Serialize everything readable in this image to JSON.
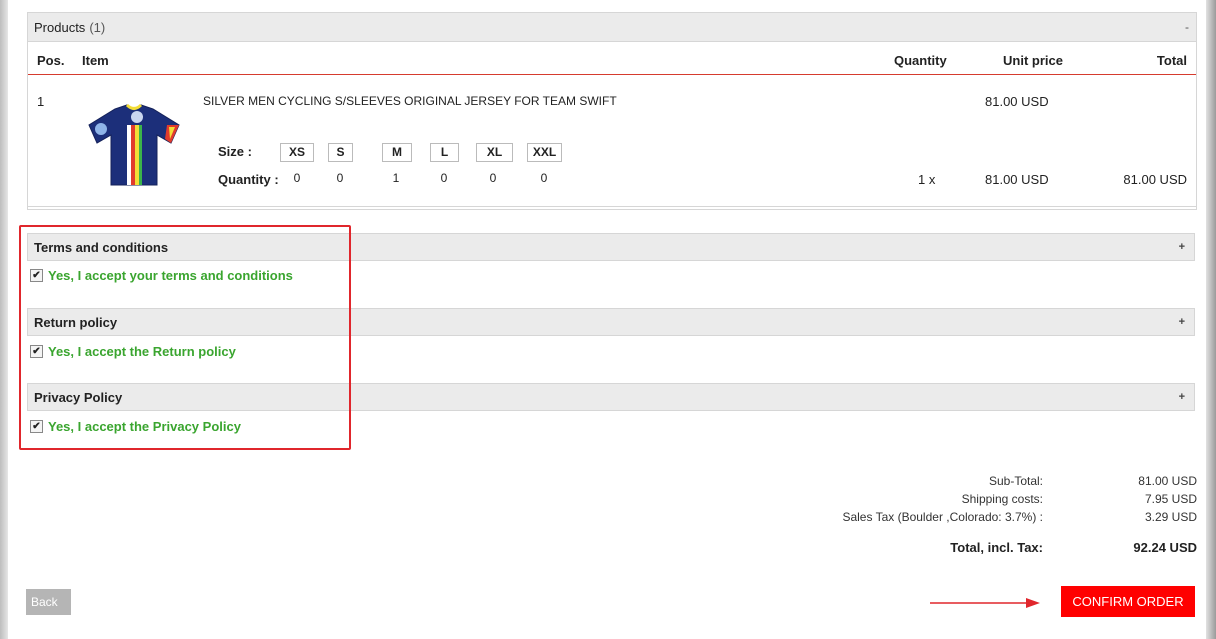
{
  "products": {
    "title": "Products",
    "count": "(1)",
    "collapse_toggle": "-",
    "columns": {
      "pos": "Pos.",
      "item": "Item",
      "quantity": "Quantity",
      "unit_price": "Unit price",
      "total": "Total"
    },
    "item": {
      "pos": "1",
      "name": "SILVER MEN CYCLING S/SLEEVES ORIGINAL JERSEY FOR TEAM SWIFT",
      "unit_price_top": "81.00 USD",
      "size_label": "Size :",
      "quantity_label": "Quantity :",
      "sizes": [
        "XS",
        "S",
        "M",
        "L",
        "XL",
        "XXL"
      ],
      "quantities": [
        "0",
        "0",
        "1",
        "0",
        "0",
        "0"
      ],
      "qty_total": "1 x",
      "unit_price": "81.00 USD",
      "total": "81.00 USD"
    }
  },
  "policies": {
    "terms": {
      "title": "Terms and conditions",
      "toggle": "+",
      "accept_label": "Yes, I accept your terms and conditions",
      "checked": true
    },
    "return": {
      "title": "Return policy",
      "toggle": "+",
      "accept_label": "Yes, I accept the Return policy",
      "checked": true
    },
    "privacy": {
      "title": "Privacy Policy",
      "toggle": "+",
      "accept_label": "Yes, I accept the Privacy Policy",
      "checked": true
    }
  },
  "totals": {
    "subtotal_label": "Sub-Total:",
    "subtotal": "81.00 USD",
    "shipping_label": "Shipping costs:",
    "shipping": "7.95 USD",
    "tax_label": "Sales Tax (Boulder ,Colorado: 3.7%) :",
    "tax": "3.29 USD",
    "grand_label": "Total, incl. Tax:",
    "grand": "92.24 USD"
  },
  "buttons": {
    "back": "Back",
    "confirm": "CONFIRM ORDER"
  },
  "colors": {
    "accept_green": "#3aa52f",
    "confirm_red": "#ff0000",
    "highlight_red": "#e0262c"
  },
  "checkmark": "✔"
}
